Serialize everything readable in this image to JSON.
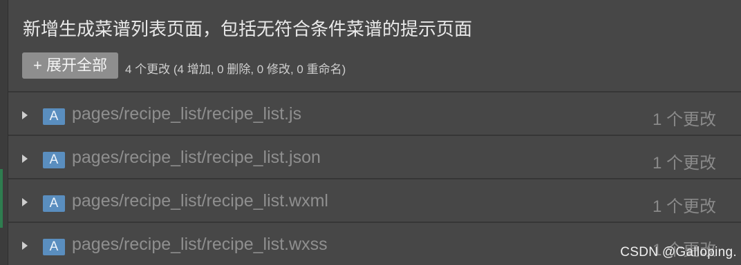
{
  "commit": {
    "title": "新增生成菜谱列表页面，包括无符合条件菜谱的提示页面",
    "expand_button": "+ 展开全部",
    "summary": "4 个更改 (4 增加, 0 删除, 0 修改, 0 重命名)"
  },
  "files": [
    {
      "status": "A",
      "path": "pages/recipe_list/recipe_list.js",
      "changes": "1 个更改"
    },
    {
      "status": "A",
      "path": "pages/recipe_list/recipe_list.json",
      "changes": "1 个更改"
    },
    {
      "status": "A",
      "path": "pages/recipe_list/recipe_list.wxml",
      "changes": "1 个更改"
    },
    {
      "status": "A",
      "path": "pages/recipe_list/recipe_list.wxss",
      "changes": "1 个更改"
    }
  ],
  "watermark": "CSDN @Galloping.",
  "colors": {
    "background": "#474747",
    "added_badge": "#5a8ebf",
    "expand_button": "#8e8e8e"
  },
  "icons": {
    "row_expander": "chevron-right-icon"
  }
}
